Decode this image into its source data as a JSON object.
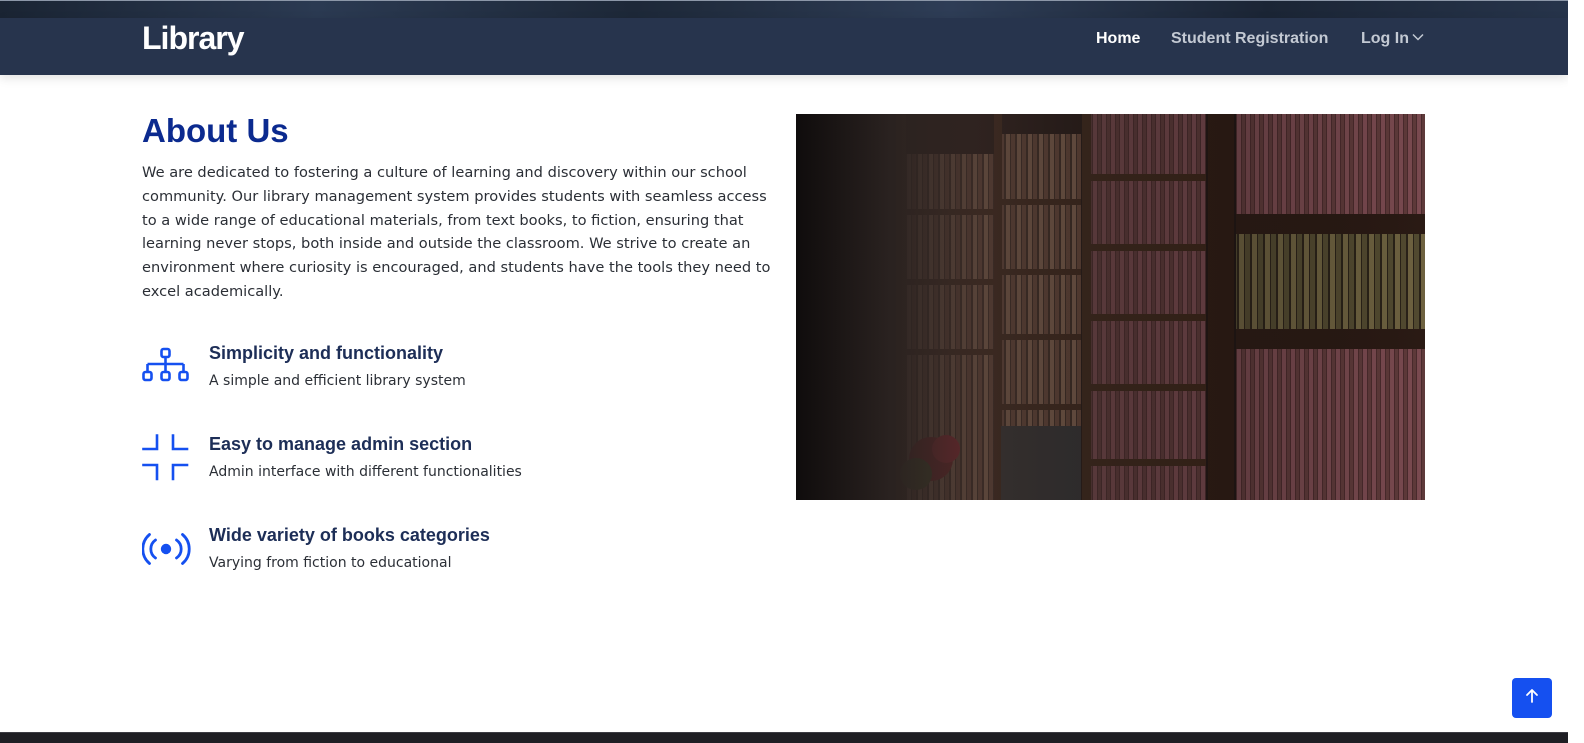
{
  "navbar": {
    "brand": "Library",
    "links": [
      {
        "label": "Home",
        "active": true
      },
      {
        "label": "Student Registration",
        "active": false
      },
      {
        "label": "Log In",
        "active": false,
        "has_dropdown": true
      }
    ]
  },
  "about": {
    "title": "About Us",
    "text": "We are dedicated to fostering a culture of learning and discovery within our school community. Our library management system provides students with seamless access to a wide range of educational materials, from text books, to fiction, ensuring that learning never stops, both inside and outside the classroom. We strive to create an environment where curiosity is encouraged, and students have the tools they need to excel academically."
  },
  "features": [
    {
      "icon": "diagram-3-icon",
      "title": "Simplicity and functionality",
      "description": "A simple and efficient library system"
    },
    {
      "icon": "fullscreen-exit-icon",
      "title": "Easy to manage admin section",
      "description": "Admin interface with different functionalities"
    },
    {
      "icon": "broadcast-icon",
      "title": "Wide variety of books categories",
      "description": "Varying from fiction to educational"
    }
  ],
  "image": {
    "subject": "library-bookshelves-photo"
  },
  "colors": {
    "navbar_bg": "#27344d",
    "title_blue": "#0b2a8f",
    "feature_title": "#1d2e57",
    "icon_blue": "#1550f0",
    "back_to_top_bg": "#1550f0"
  },
  "back_to_top": {
    "icon": "arrow-up-icon"
  }
}
